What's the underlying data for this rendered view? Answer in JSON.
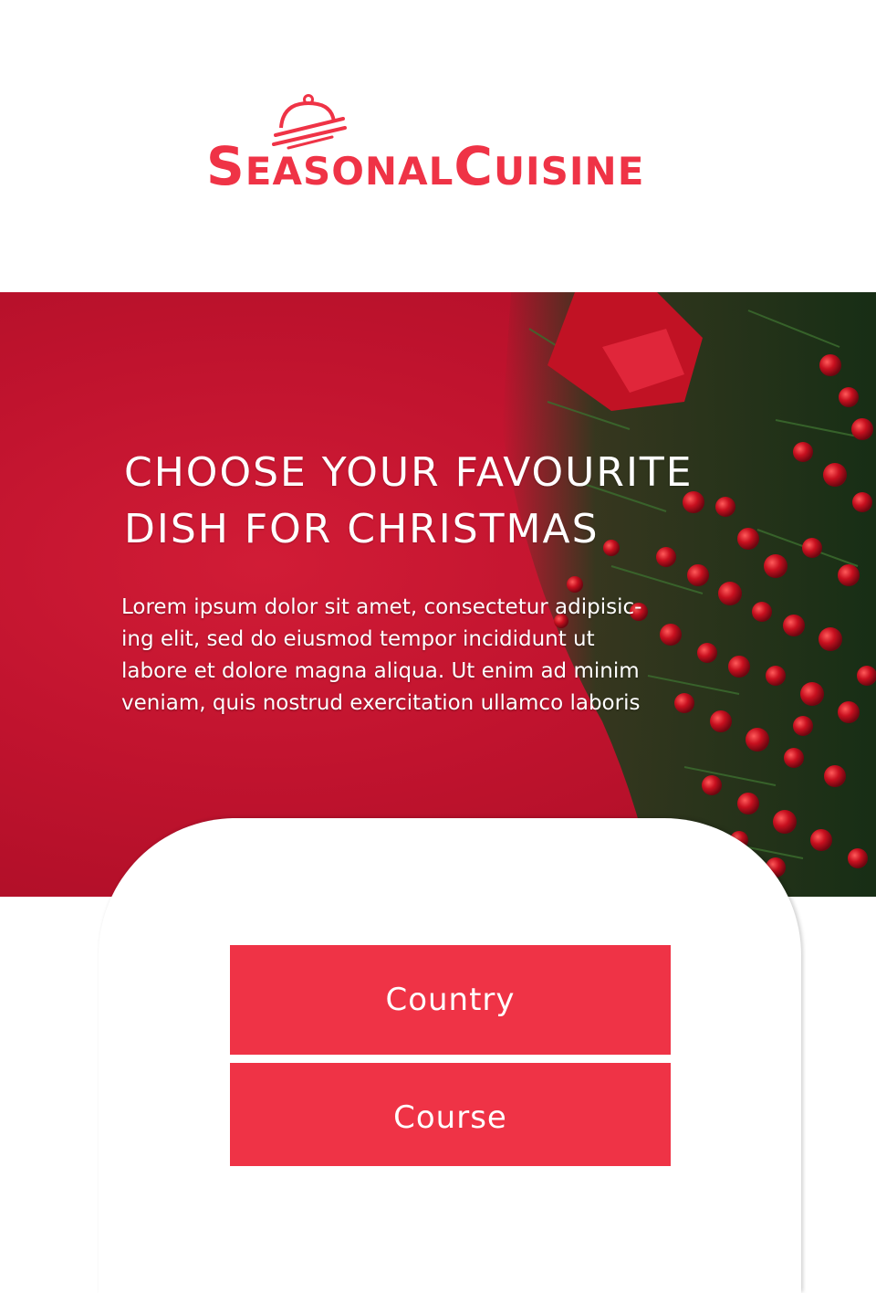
{
  "brand": {
    "name_part1_cap": "S",
    "name_part1_rest": "EASONAL",
    "name_part2_cap": "C",
    "name_part2_rest": "UISINE",
    "color": "#ef3346"
  },
  "hero": {
    "title_line1": "CHOOSE YOUR FAVOURITE",
    "title_line2": "DISH FOR CHRISTMAS",
    "body_line1": "Lorem ipsum dolor sit amet, consectetur adipisic-",
    "body_line2": "ing elit, sed do eiusmod tempor incididunt ut",
    "body_line3": "labore et dolore magna aliqua. Ut enim ad minim",
    "body_line4": "veniam, quis nostrud exercitation ullamco laboris",
    "background_color": "#c0132e"
  },
  "options": {
    "country_label": "Country",
    "course_label": "Course",
    "button_color": "#ef3346"
  }
}
